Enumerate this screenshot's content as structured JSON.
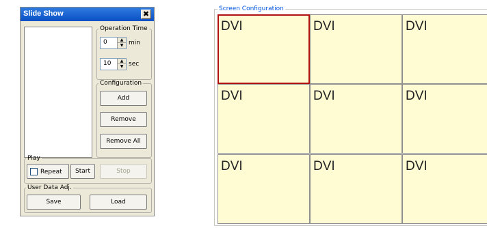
{
  "dialog": {
    "title": "Slide Show",
    "close_glyph": "✖",
    "operation_time": {
      "legend": "Operation Time",
      "minutes": "0",
      "min_unit": "min",
      "seconds": "10",
      "sec_unit": "sec",
      "spin_up": "▲",
      "spin_down": "▼"
    },
    "configuration": {
      "legend": "Configuration",
      "add": "Add",
      "remove": "Remove",
      "remove_all": "Remove All"
    },
    "play": {
      "legend": "Play",
      "repeat_label": "Repeat",
      "repeat_checked": false,
      "start": "Start",
      "stop": "Stop"
    },
    "user_data": {
      "legend": "User Data Adj.",
      "save": "Save",
      "load": "Load"
    }
  },
  "screen_config": {
    "title": "Screen Configuration",
    "selected_index": 0,
    "cells": [
      "DVI",
      "DVI",
      "DVI",
      "DVI",
      "DVI",
      "DVI",
      "DVI",
      "DVI",
      "DVI"
    ]
  },
  "colors": {
    "titlebar": "#0a4fc4",
    "cell_fill": "#fffbd2",
    "selected_border": "#b01010",
    "group_title": "#0054e3"
  },
  "icons": {
    "close": "close-icon",
    "spin": "spin-arrows-icon",
    "checkbox": "checkbox-icon"
  }
}
